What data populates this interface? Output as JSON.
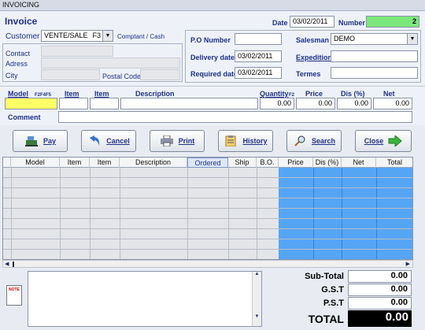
{
  "window": {
    "title": "INVOICING"
  },
  "header": {
    "invoice_label": "Invoice",
    "date_label": "Date",
    "date_value": "03/02/2011",
    "number_label": "Number",
    "number_value": "2"
  },
  "customer": {
    "label": "Customer",
    "value": "VENTE/SALE",
    "hotkey": "F3",
    "comptant": "Comptant / Cash",
    "contact_label": "Contact",
    "adress_label": "Adress",
    "city_label": "City",
    "postal_label": "Postal Code"
  },
  "order": {
    "po_label": "P.O Number",
    "po_value": "",
    "delivery_label": "Delivery date",
    "delivery_value": "03/02/2011",
    "required_label": "Required date",
    "required_value": "03/02/2011",
    "salesman_label": "Salesman",
    "salesman_value": "DEMO",
    "expedition_label": "Expedition",
    "termes_label": "Termes"
  },
  "entry": {
    "model_label": "Model",
    "model_hotkeys": "F2F4F5",
    "item1_label": "Item",
    "item2_label": "Item",
    "description_label": "Description",
    "quantity_label": "Quantity",
    "quantity_hotkey": "F2",
    "price_label": "Price",
    "dis_label": "Dis (%)",
    "net_label": "Net",
    "quantity_value": "0.00",
    "price_value": "0.00",
    "dis_value": "0.00",
    "net_value": "0.00",
    "comment_label": "Comment"
  },
  "buttons": {
    "pay": "Pay",
    "cancel": "Cancel",
    "print": "Print",
    "history": "History",
    "search": "Search",
    "close": "Close"
  },
  "grid": {
    "columns": [
      "Model",
      "Item",
      "Item",
      "Description",
      "Ordered",
      "Ship",
      "B.O.",
      "Price",
      "Dis (%)",
      "Net",
      "Total"
    ]
  },
  "totals": {
    "subtotal_label": "Sub-Total",
    "subtotal_value": "0.00",
    "gst_label": "G.S.T",
    "gst_value": "0.00",
    "pst_label": "P.S.T",
    "pst_value": "0.00",
    "total_label": "TOTAL",
    "total_value": "0.00"
  },
  "note_icon_label": "NOTE",
  "colors": {
    "accent_green": "#7ce87c",
    "highlight_yellow": "#ffff66",
    "grid_blue": "#55a5f5",
    "total_black": "#000000"
  }
}
